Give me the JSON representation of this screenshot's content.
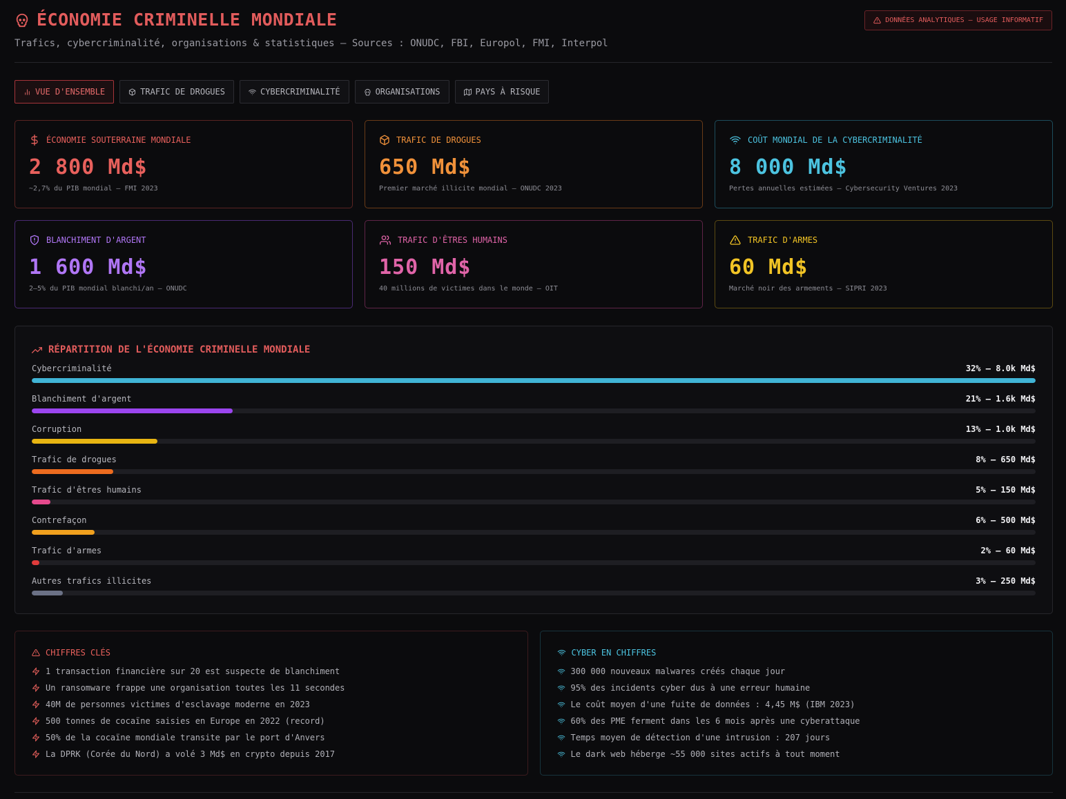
{
  "header": {
    "title": "ÉCONOMIE CRIMINELLE MONDIALE",
    "subtitle": "Trafics, cybercriminalité, organisations & statistiques — Sources : ONUDC, FBI, Europol, FMI, Interpol",
    "badge": "DONNÉES ANALYTIQUES — USAGE INFORMATIF",
    "title_icon": "skull-icon"
  },
  "tabs": [
    {
      "label": "VUE D'ENSEMBLE",
      "icon": "bar-chart-icon",
      "active": true
    },
    {
      "label": "TRAFIC DE DROGUES",
      "icon": "box-icon",
      "active": false
    },
    {
      "label": "CYBERCRIMINALITÉ",
      "icon": "wifi-icon",
      "active": false
    },
    {
      "label": "ORGANISATIONS",
      "icon": "skull-icon",
      "active": false
    },
    {
      "label": "PAYS À RISQUE",
      "icon": "map-icon",
      "active": false
    }
  ],
  "cards": [
    {
      "title": "ÉCONOMIE SOUTERRAINE MONDIALE",
      "value": "2 800 Md$",
      "note": "~2,7% du PIB mondial — FMI 2023",
      "icon": "dollar-icon",
      "color": "#e8605c",
      "border": "#5a2422"
    },
    {
      "title": "TRAFIC DE DROGUES",
      "value": "650 Md$",
      "note": "Premier marché illicite mondial — ONUDC 2023",
      "icon": "box-icon",
      "color": "#f0913a",
      "border": "#6a3b17"
    },
    {
      "title": "COÛT MONDIAL DE LA CYBERCRIMINALITÉ",
      "value": "8 000 Md$",
      "note": "Pertes annuelles estimées — Cybersecurity Ventures 2023",
      "icon": "wifi-icon",
      "color": "#4cc3e0",
      "border": "#1d4d5c"
    },
    {
      "title": "BLANCHIMENT D'ARGENT",
      "value": "1 600 Md$",
      "note": "2–5% du PIB mondial blanchi/an — ONUDC",
      "icon": "shield-icon",
      "color": "#b076f5",
      "border": "#4a2a72"
    },
    {
      "title": "TRAFIC D'ÊTRES HUMAINS",
      "value": "150 Md$",
      "note": "40 millions de victimes dans le monde — OIT",
      "icon": "users-icon",
      "color": "#e064a8",
      "border": "#5f2447"
    },
    {
      "title": "TRAFIC D'ARMES",
      "value": "60 Md$",
      "note": "Marché noir des armements — SIPRI 2023",
      "icon": "warning-icon",
      "color": "#f2c425",
      "border": "#5c4a12"
    }
  ],
  "panel": {
    "title": "RÉPARTITION DE L'ÉCONOMIE CRIMINELLE MONDIALE",
    "icon": "trending-up-icon"
  },
  "chart_data": {
    "type": "bar",
    "categories": [
      "Cybercriminalité",
      "Blanchiment d'argent",
      "Corruption",
      "Trafic de drogues",
      "Trafic d'êtres humains",
      "Contrefaçon",
      "Trafic d'armes",
      "Autres trafics illicites"
    ],
    "value_labels": [
      "32% — 8.0k Md$",
      "21% — 1.6k Md$",
      "13% — 1.0k Md$",
      "8% — 650 Md$",
      "5% — 150 Md$",
      "6% — 500 Md$",
      "2% — 60 Md$",
      "3% — 250 Md$"
    ],
    "values": [
      8000,
      1600,
      1000,
      650,
      150,
      500,
      60,
      250
    ],
    "percentages": [
      32,
      21,
      13,
      8,
      5,
      6,
      2,
      3
    ],
    "colors": [
      "#40b4d6",
      "#9b45ef",
      "#e8b512",
      "#ec6b1f",
      "#e5498d",
      "#f0a01e",
      "#e03b3b",
      "#6b7186"
    ],
    "xlim": [
      0,
      8000
    ]
  },
  "key_figures": {
    "title": "CHIFFRES CLÉS",
    "icon": "warning-icon",
    "item_icon": "zap-icon",
    "color": "#e8605c",
    "border": "#3d1b1e",
    "items": [
      "1 transaction financière sur 20 est suspecte de blanchiment",
      "Un ransomware frappe une organisation toutes les 11 secondes",
      "40M de personnes victimes d'esclavage moderne en 2023",
      "500 tonnes de cocaïne saisies en Europe en 2022 (record)",
      "50% de la cocaïne mondiale transite par le port d'Anvers",
      "La DPRK (Corée du Nord) a volé 3 Md$ en crypto depuis 2017"
    ]
  },
  "cyber_figures": {
    "title": "CYBER EN CHIFFRES",
    "icon": "wifi-icon",
    "item_icon": "wifi-icon",
    "color": "#4cc3e0",
    "border": "#17343d",
    "items": [
      "300 000 nouveaux malwares créés chaque jour",
      "95% des incidents cyber dus à une erreur humaine",
      "Le coût moyen d'une fuite de données : 4,45 M$ (IBM 2023)",
      "60% des PME ferment dans les 6 mois après une cyberattaque",
      "Temps moyen de détection d'une intrusion : 207 jours",
      "Le dark web héberge ~55 000 sites actifs à tout moment"
    ]
  }
}
